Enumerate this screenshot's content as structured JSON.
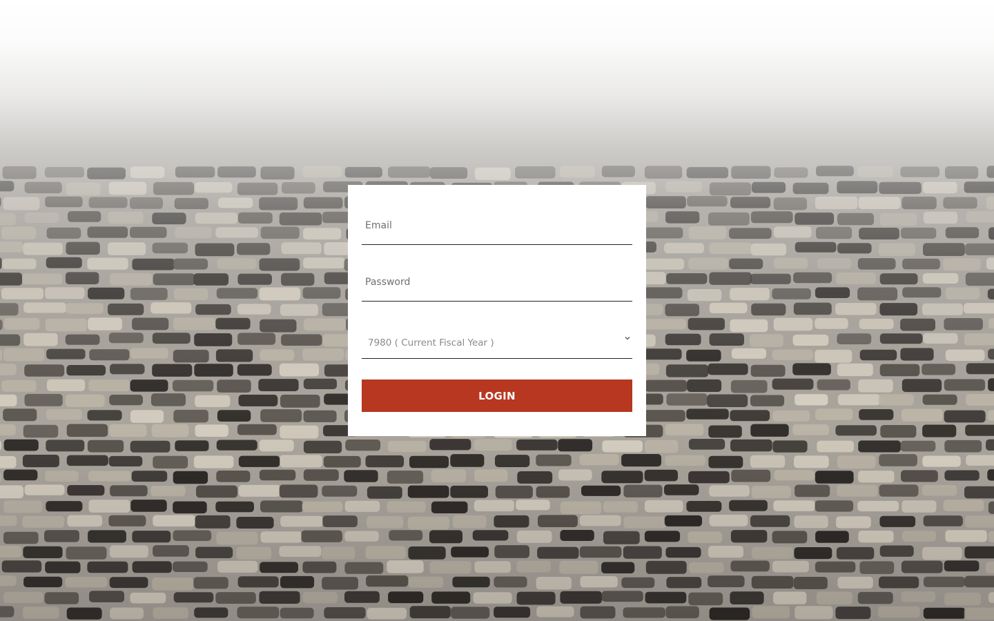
{
  "login": {
    "email_placeholder": "Email",
    "password_placeholder": "Password",
    "fiscal_year_selected": "7980 ( Current Fiscal Year )",
    "login_label": "LOGIN"
  },
  "colors": {
    "accent": "#b73721",
    "card": "#ffffff"
  },
  "icons": {
    "select": "chevron-down-icon"
  }
}
